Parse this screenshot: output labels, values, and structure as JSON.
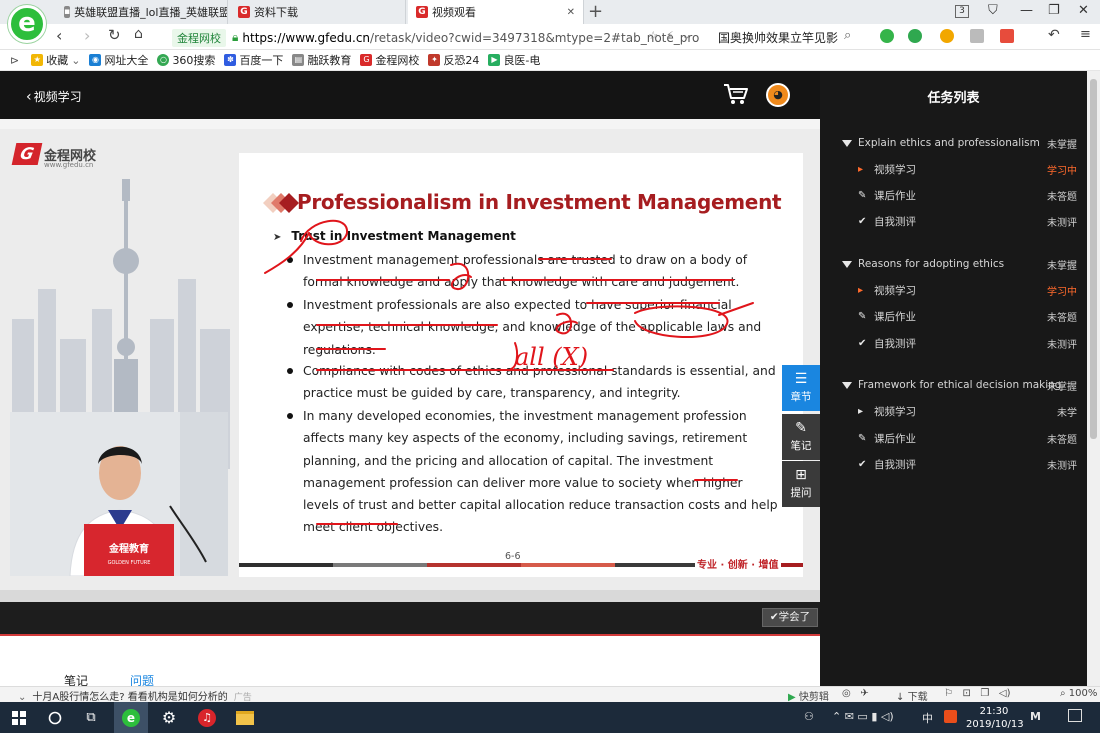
{
  "browser": {
    "tabs": [
      {
        "label": "英雄联盟直播_lol直播_英雄联盟",
        "icon": "game-tab-icon"
      },
      {
        "label": "资料下载",
        "icon": "gfedu-tab-icon"
      },
      {
        "label": "视频观看",
        "icon": "gfedu-tab-icon",
        "active": true
      }
    ],
    "tab_count": "3",
    "address": {
      "site_label": "金程网校",
      "url_domain": "https://www.gfedu.cn",
      "url_path": "/retask/video?cwid=3497318&mtype=2#tab_note_pro"
    },
    "news_ticker": "国奥换帅效果立竿见影",
    "bookmarks": [
      {
        "label": "收藏",
        "icon": "star-icon",
        "color": "#f2b705"
      },
      {
        "label": "网址大全",
        "icon": "globe-icon",
        "color": "#1a7fd4"
      },
      {
        "label": "360搜索",
        "icon": "search-icon",
        "color": "#34a853"
      },
      {
        "label": "百度一下",
        "icon": "paw-icon",
        "color": "#2f5ce0"
      },
      {
        "label": "融跃教育",
        "icon": "doc-icon",
        "color": "#888888"
      },
      {
        "label": "金程网校",
        "icon": "gfedu-icon",
        "color": "#d92a2a"
      },
      {
        "label": "反恐24",
        "icon": "game-icon",
        "color": "#c0392b"
      },
      {
        "label": "良医-电",
        "icon": "video-icon",
        "color": "#27ae60"
      }
    ]
  },
  "header": {
    "back_label": "视频学习"
  },
  "task_panel": {
    "title": "任务列表",
    "chapters": [
      {
        "title": "Explain ethics and professionalism",
        "status": "未掌握",
        "tasks": [
          {
            "label": "视频学习",
            "status": "学习中",
            "icon": "play-icon",
            "active": true
          },
          {
            "label": "课后作业",
            "status": "未答题",
            "icon": "pencil-icon"
          },
          {
            "label": "自我测评",
            "status": "未测评",
            "icon": "check-icon"
          }
        ]
      },
      {
        "title": "Reasons for adopting ethics",
        "status": "未掌握",
        "tasks": [
          {
            "label": "视频学习",
            "status": "学习中",
            "icon": "play-icon",
            "active": true
          },
          {
            "label": "课后作业",
            "status": "未答题",
            "icon": "pencil-icon"
          },
          {
            "label": "自我测评",
            "status": "未测评",
            "icon": "check-icon"
          }
        ]
      },
      {
        "title": "Framework for ethical decision making",
        "status": "未掌握",
        "tasks": [
          {
            "label": "视频学习",
            "status": "未学",
            "icon": "play-icon"
          },
          {
            "label": "课后作业",
            "status": "未答题",
            "icon": "pencil-icon"
          },
          {
            "label": "自我测评",
            "status": "未测评",
            "icon": "check-icon"
          }
        ]
      }
    ]
  },
  "video": {
    "brand_name": "金程网校",
    "brand_domain": "www.gfedu.cn",
    "laptop_label": "金程教育",
    "laptop_sub": "GOLDEN FUTURE",
    "slide": {
      "title": "Professionalism in Investment Management",
      "heading": "Trust in Investment Management",
      "bullets": [
        "Investment management professionals are trusted to draw on a body of formal knowledge and apply that knowledge with care and judgement.",
        "Investment professionals are also expected to have superior financial expertise, technical knowledge, and knowledge of the applicable laws and regulations.",
        "Compliance with codes of ethics and professional standards is essential, and practice must be guided by care, transparency, and integrity.",
        "In many developed economies, the investment management profession affects many key aspects of the economy, including savings, retirement planning, and the pricing and allocation of capital. The investment management profession can deliver more value to society when higher levels of trust and better capital allocation reduce transaction costs and help meet client objectives."
      ],
      "handwriting": "all (X)",
      "page_number": "6-6",
      "slogan": "专业 · 创新 · 增值"
    },
    "side_tools": [
      {
        "label": "章节",
        "icon": "list-icon"
      },
      {
        "label": "笔记",
        "icon": "pencil-icon"
      },
      {
        "label": "提问",
        "icon": "chat-plus-icon"
      }
    ],
    "learned_button": "✔学会了"
  },
  "lower_tabs": {
    "notes": "笔记",
    "questions": "问题"
  },
  "statusbar": {
    "news": "十月A股行情怎么走? 看看机构是如何分析的",
    "ad": "广告",
    "items": [
      "快剪辑",
      "下载",
      "100%"
    ]
  },
  "taskbar": {
    "time": "21:30",
    "date": "2019/10/13",
    "ime": "中"
  },
  "colors": {
    "accent_blue": "#1a86e0",
    "brand_red": "#a61d20",
    "status_orange": "#ff6a2c",
    "ink_red": "#e0151b"
  }
}
